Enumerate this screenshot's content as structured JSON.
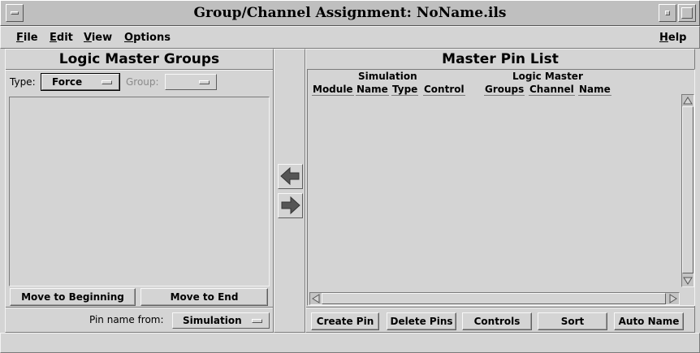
{
  "window": {
    "title": "Group/Channel Assignment: NoName.ils"
  },
  "menubar": {
    "file": "File",
    "edit": "Edit",
    "view": "View",
    "options": "Options",
    "help": "Help"
  },
  "left_panel": {
    "title": "Logic Master Groups",
    "type_label": "Type:",
    "type_value": "Force",
    "group_label": "Group:",
    "group_value": "",
    "move_to_beginning": "Move to Beginning",
    "move_to_end": "Move to End",
    "pin_name_from_label": "Pin name from:",
    "pin_name_from_value": "Simulation"
  },
  "right_panel": {
    "title": "Master Pin List",
    "simulation_header": "Simulation",
    "logic_master_header": "Logic Master",
    "columns": [
      "Module",
      "Name",
      "Type",
      "Control",
      "Groups",
      "Channel",
      "Name"
    ],
    "buttons": [
      "Create Pin",
      "Delete Pins",
      "Controls",
      "Sort",
      "Auto Name"
    ]
  },
  "icons": {
    "window_menu": "window-menu-icon",
    "minimize": "minimize-icon",
    "maximize": "maximize-icon",
    "arrow_left": "arrow-left-icon",
    "arrow_right": "arrow-right-icon"
  },
  "colors": {
    "background": "#d4d4d4",
    "titlebar": "#bfbfbf"
  }
}
